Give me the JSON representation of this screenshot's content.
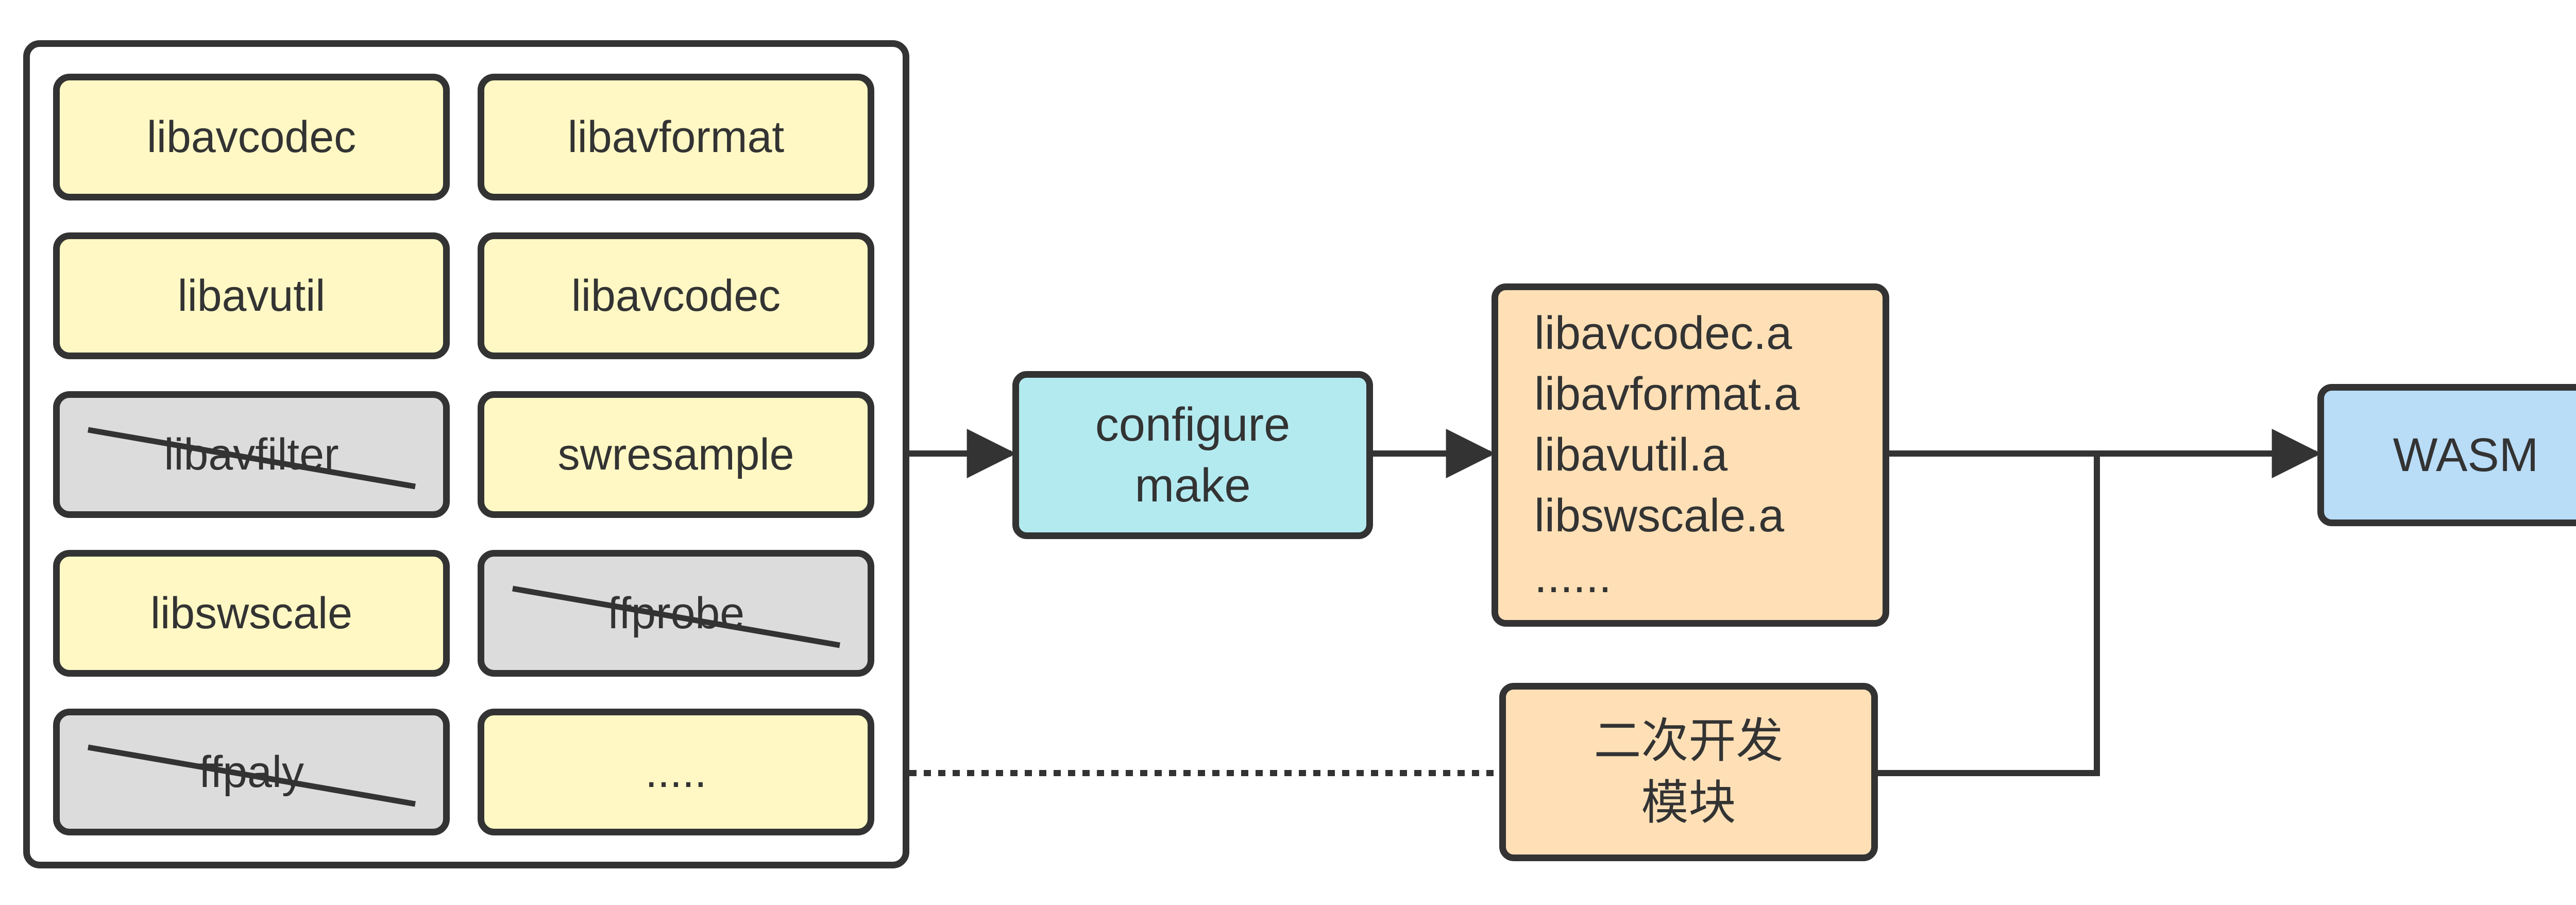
{
  "libraries": [
    {
      "label": "libavcodec",
      "excluded": false
    },
    {
      "label": "libavformat",
      "excluded": false
    },
    {
      "label": "libavutil",
      "excluded": false
    },
    {
      "label": "libavcodec",
      "excluded": false
    },
    {
      "label": "libavfilter",
      "excluded": true
    },
    {
      "label": "swresample",
      "excluded": false
    },
    {
      "label": "libswscale",
      "excluded": false
    },
    {
      "label": "ffprobe",
      "excluded": true
    },
    {
      "label": "ffpaly",
      "excluded": true
    },
    {
      "label": ".....",
      "excluded": false
    }
  ],
  "build_step": {
    "line1": "configure",
    "line2": "make"
  },
  "outputs": {
    "lines": [
      "libavcodec.a",
      "libavformat.a",
      "libavutil.a",
      "libswscale.a",
      "......"
    ]
  },
  "secondary_module": {
    "line1": "二次开发",
    "line2": "模块"
  },
  "target": {
    "label": "WASM"
  },
  "colors": {
    "stroke": "#333333",
    "kept_library": "#fff8c4",
    "excluded_library": "#dcdcdc",
    "build_step": "#b3eaf0",
    "outputs": "#ffe0b6",
    "target": "#b9dcf7"
  }
}
